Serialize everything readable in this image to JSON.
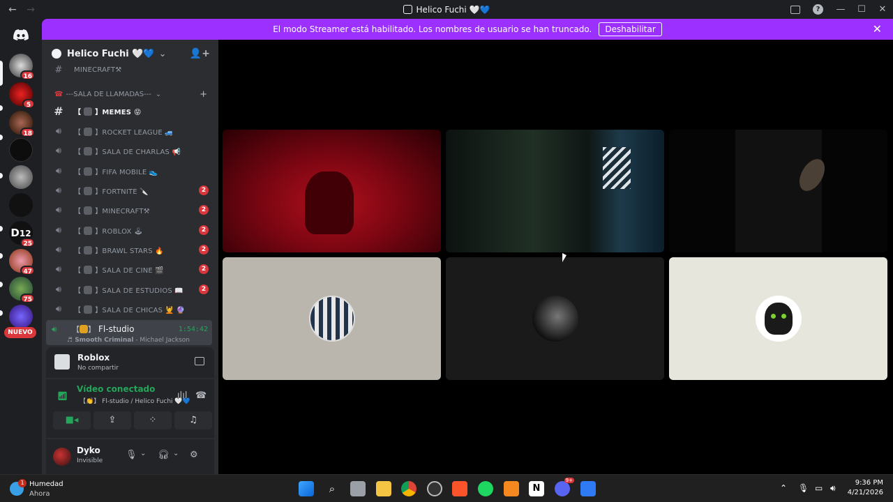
{
  "window": {
    "title": "Helico Fuchi 🤍💙",
    "back": "←",
    "forward": "→",
    "help": "?",
    "minimize": "—",
    "maximize": "☐",
    "close": "✕"
  },
  "banner": {
    "message": "El modo Streamer está habilitado. Los nombres de usuario se han truncado.",
    "button": "Deshabilitar",
    "close": "✕"
  },
  "servers": {
    "badges": [
      "16",
      "5",
      "18",
      "25",
      "47",
      "75"
    ],
    "new_label": "NUEVO"
  },
  "guild": {
    "name": "Helico Fuchi 🤍💙",
    "chevron": "⌄",
    "invite": "👤+"
  },
  "channels": {
    "top_partial": "MINECRAFT⚒",
    "category": "---SALA DE LLAMADAS---",
    "category_plus": "+",
    "list": [
      {
        "name": "MEMES 😝",
        "type": "text",
        "count": ""
      },
      {
        "name": "ROCKET LEAGUE 🚙",
        "type": "voice",
        "count": ""
      },
      {
        "name": "SALA DE CHARLAS 📢",
        "type": "voice",
        "count": ""
      },
      {
        "name": "FIFA MOBILE 👟",
        "type": "voice",
        "count": ""
      },
      {
        "name": "FORTNITE 🔪",
        "type": "voice",
        "count": "2"
      },
      {
        "name": "MINECRAFT⚒",
        "type": "voice",
        "count": "2"
      },
      {
        "name": "ROBLOX 🕹",
        "type": "voice",
        "count": "2"
      },
      {
        "name": "BRAWL STARS 🔥",
        "type": "voice",
        "count": "2"
      },
      {
        "name": "SALA DE CINE 🎬",
        "type": "voice",
        "count": "2"
      },
      {
        "name": "SALA DE ESTUDIOS 📖",
        "type": "voice",
        "count": "2"
      },
      {
        "name": "SALA DE CHICAS 💆 🔮",
        "type": "voice",
        "count": ""
      }
    ],
    "active": {
      "name": "Fl-studio",
      "time": "1:54:42",
      "song": "♬ Smooth Criminal",
      "artist": " - Michael Jackson"
    }
  },
  "activity": {
    "game": "Roblox",
    "sub": "No compartir"
  },
  "voice": {
    "status": "Vídeo conectado",
    "location": "【👏】 Fl-studio / Helico Fuchi 🤍💙"
  },
  "user": {
    "name": "Dyko",
    "status": "Invisible"
  },
  "taskbar": {
    "weather_title": "Humedad",
    "weather_sub": "Ahora",
    "weather_badge": "1",
    "time": "9:36 PM",
    "date": "4/21/2026",
    "discord_badge": "9+"
  },
  "colors": {
    "banner": "#9b30ff",
    "green": "#23a55a",
    "badge_red": "#da373c",
    "sidebar": "#2b2d31"
  }
}
